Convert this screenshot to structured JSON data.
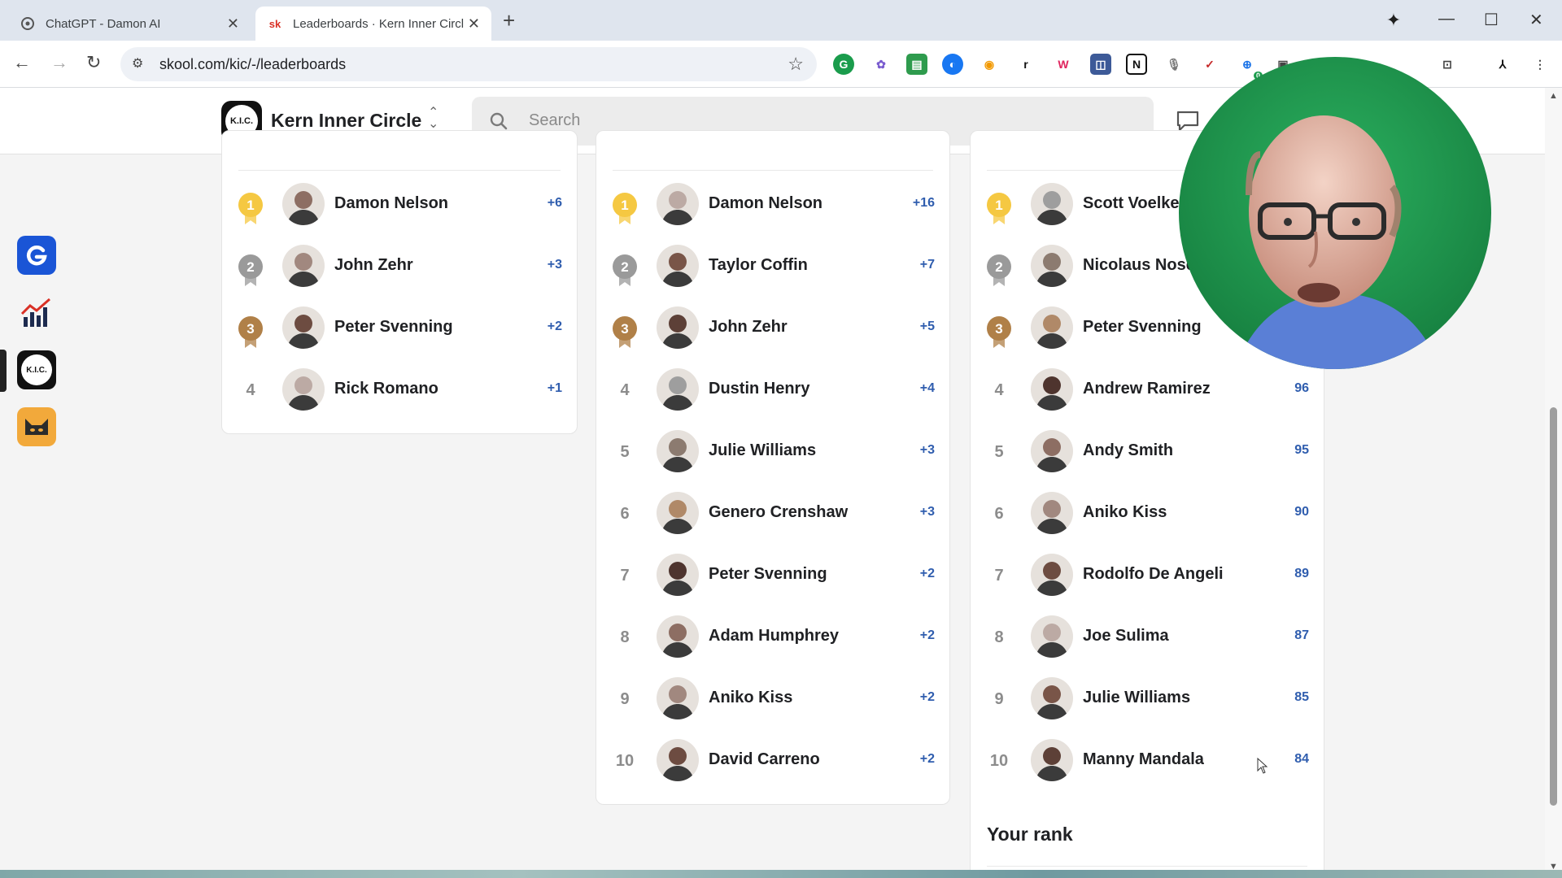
{
  "browser": {
    "tabs": [
      {
        "title": "ChatGPT - Damon AI",
        "favicon": "chatgpt-icon",
        "active": false
      },
      {
        "title": "Leaderboards · Kern Inner Circle",
        "favicon": "skool-icon",
        "favicon_text": "sk",
        "active": true
      }
    ],
    "url": "skool.com/kic/-/leaderboards",
    "extension_badge": "0"
  },
  "header": {
    "logo_text": "K.I.C.",
    "community_name": "Kern Inner Circle",
    "search_placeholder": "Search"
  },
  "rail": [
    {
      "name": "g-app",
      "label": "G"
    },
    {
      "name": "chart-app",
      "label": ""
    },
    {
      "name": "kic-app",
      "label": "K.I.C."
    },
    {
      "name": "cat-app",
      "label": ""
    }
  ],
  "leaderboards": [
    {
      "rows": [
        {
          "rank": "1",
          "name": "Damon Nelson",
          "points": "+6"
        },
        {
          "rank": "2",
          "name": "John Zehr",
          "points": "+3"
        },
        {
          "rank": "3",
          "name": "Peter Svenning",
          "points": "+2"
        },
        {
          "rank": "4",
          "name": "Rick Romano",
          "points": "+1"
        }
      ]
    },
    {
      "rows": [
        {
          "rank": "1",
          "name": "Damon Nelson",
          "points": "+16"
        },
        {
          "rank": "2",
          "name": "Taylor Coffin",
          "points": "+7"
        },
        {
          "rank": "3",
          "name": "John Zehr",
          "points": "+5"
        },
        {
          "rank": "4",
          "name": "Dustin Henry",
          "points": "+4"
        },
        {
          "rank": "5",
          "name": "Julie Williams",
          "points": "+3"
        },
        {
          "rank": "6",
          "name": "Genero Crenshaw",
          "points": "+3"
        },
        {
          "rank": "7",
          "name": "Peter Svenning",
          "points": "+2"
        },
        {
          "rank": "8",
          "name": "Adam Humphrey",
          "points": "+2"
        },
        {
          "rank": "9",
          "name": "Aniko Kiss",
          "points": "+2"
        },
        {
          "rank": "10",
          "name": "David Carreno",
          "points": "+2"
        }
      ]
    },
    {
      "rows": [
        {
          "rank": "1",
          "name": "Scott Voelker",
          "points": ""
        },
        {
          "rank": "2",
          "name": "Nicolaus Nosev",
          "points": ""
        },
        {
          "rank": "3",
          "name": "Peter Svenning",
          "points": ""
        },
        {
          "rank": "4",
          "name": "Andrew Ramirez",
          "points": "96"
        },
        {
          "rank": "5",
          "name": "Andy Smith",
          "points": "95"
        },
        {
          "rank": "6",
          "name": "Aniko Kiss",
          "points": "90"
        },
        {
          "rank": "7",
          "name": "Rodolfo De Angeli",
          "points": "89"
        },
        {
          "rank": "8",
          "name": "Joe Sulima",
          "points": "87"
        },
        {
          "rank": "9",
          "name": "Julie Williams",
          "points": "85"
        },
        {
          "rank": "10",
          "name": "Manny Mandala",
          "points": "84"
        }
      ],
      "your_rank_label": "Your rank"
    }
  ],
  "colors": {
    "gold": "#f5c842",
    "silver": "#9a9a9a",
    "bronze": "#b08048",
    "points": "#2f5dae",
    "webcam_bg": "#1f8c4e"
  }
}
